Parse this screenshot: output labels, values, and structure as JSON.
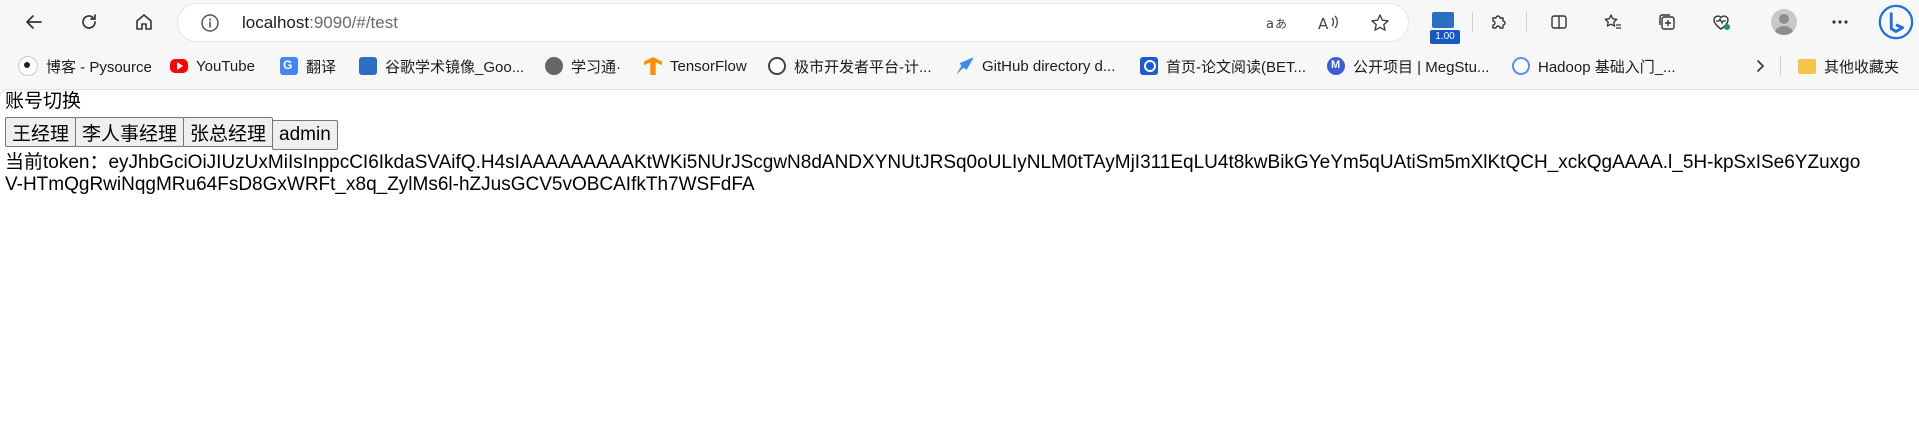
{
  "browser": {
    "url_host": "localhost",
    "url_path": ":9090/#/test",
    "extension_badge": "1.00",
    "colors": {
      "accent": "#1657c4",
      "background": "#f7f7f7"
    }
  },
  "bookmarks": [
    {
      "label": "博客 - Pysource",
      "icon": "pysource-icon",
      "color": "#222222"
    },
    {
      "label": "YouTube",
      "icon": "youtube-icon",
      "color": "#ff0000"
    },
    {
      "label": "翻译",
      "icon": "translate-icon",
      "color": "#4285f4"
    },
    {
      "label": "谷歌学术镜像_Goo...",
      "icon": "scholar-mirror-icon",
      "color": "#2a6fc0"
    },
    {
      "label": "学习通·",
      "icon": "globe-icon",
      "color": "#666666"
    },
    {
      "label": "TensorFlow",
      "icon": "tensorflow-icon",
      "color": "#ff8f00"
    },
    {
      "label": "极市开发者平台-计...",
      "icon": "extreme-mart-icon",
      "color": "#444444"
    },
    {
      "label": "GitHub directory d...",
      "icon": "rocket-icon",
      "color": "#3b8bea"
    },
    {
      "label": "首页-论文阅读(BET...",
      "icon": "paper-reading-icon",
      "color": "#1a5bd6"
    },
    {
      "label": "公开项目 | MegStu...",
      "icon": "megstudio-icon",
      "color": "#3c5bd8"
    },
    {
      "label": "Hadoop 基础入门_...",
      "icon": "hadoop-icon",
      "color": "#5a8df0"
    }
  ],
  "bookmarks_other": "其他收藏夹",
  "page": {
    "title": "账号切换",
    "accounts": [
      "王经理",
      "李人事经理",
      "张总经理",
      "admin"
    ],
    "token_label": "当前token：",
    "token_value": "eyJhbGciOiJIUzUxMiIsInppcCI6IkdaSVAifQ.H4sIAAAAAAAAAKtWKi5NUrJScgwN8dANDXYNUtJRSq0oULIyNLM0tTAyMjI311EqLU4t8kwBikGYeYm5qUAtiSm5mXlKtQCH_xckQgAAAA.l_5H-kpSxISe6YZuxgoV-HTmQgRwiNqgMRu64FsD8GxWRFt_x8q_ZylMs6l-hZJusGCV5vOBCAIfkTh7WSFdFA"
  }
}
